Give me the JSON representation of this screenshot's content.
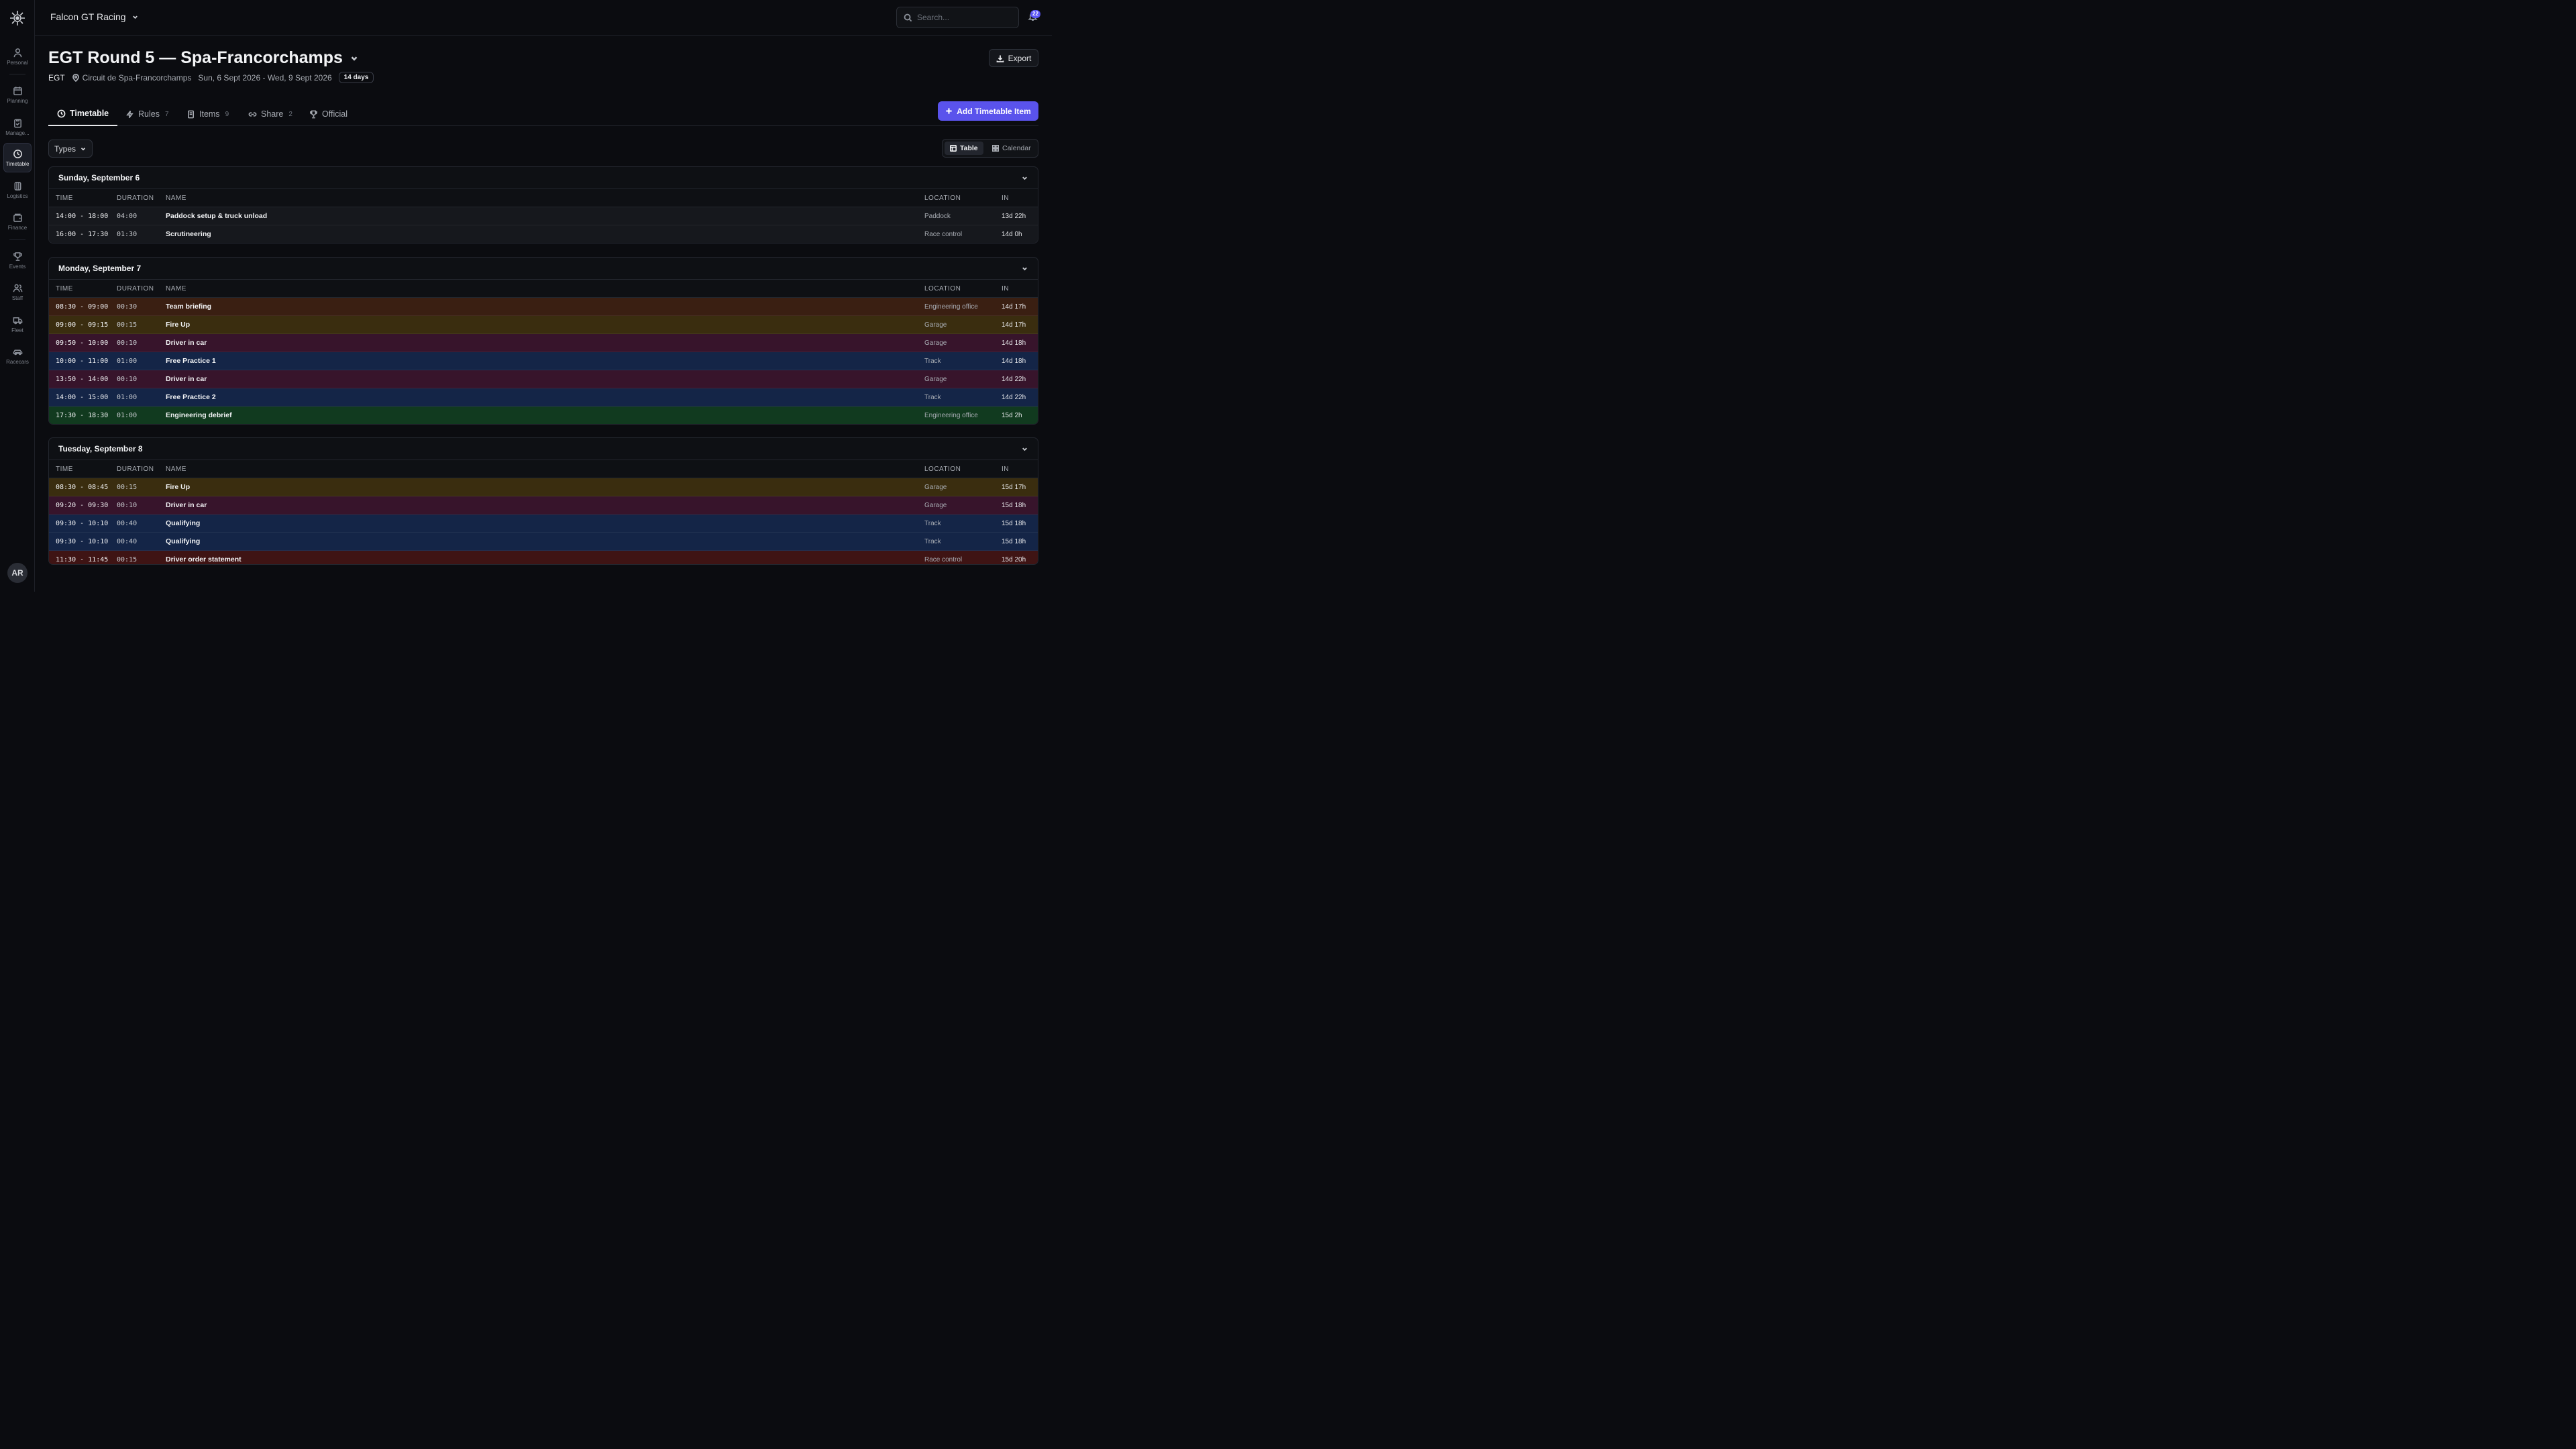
{
  "sidebar": {
    "items": [
      {
        "label": "Personal",
        "icon": "user-icon"
      },
      {
        "label": "Planning",
        "icon": "calendar-icon"
      },
      {
        "label": "Manage...",
        "icon": "clipboard-icon"
      },
      {
        "label": "Timetable",
        "icon": "clock-icon"
      },
      {
        "label": "Logistics",
        "icon": "box-icon"
      },
      {
        "label": "Finance",
        "icon": "wallet-icon"
      },
      {
        "label": "Events",
        "icon": "trophy-icon"
      },
      {
        "label": "Staff",
        "icon": "users-icon"
      },
      {
        "label": "Fleet",
        "icon": "truck-icon"
      },
      {
        "label": "Racecars",
        "icon": "car-icon"
      }
    ],
    "avatar": "AR"
  },
  "topbar": {
    "team": "Falcon GT Racing",
    "search_placeholder": "Search...",
    "notification_count": "22"
  },
  "header": {
    "title": "EGT Round 5 — Spa-Francorchamps",
    "series": "EGT",
    "circuit": "Circuit de Spa-Francorchamps",
    "dates": "Sun, 6 Sept 2026 - Wed, 9 Sept 2026",
    "duration_badge": "14 days",
    "export_label": "Export"
  },
  "tabs": [
    {
      "label": "Timetable",
      "count": ""
    },
    {
      "label": "Rules",
      "count": "7"
    },
    {
      "label": "Items",
      "count": "9"
    },
    {
      "label": "Share",
      "count": "2"
    },
    {
      "label": "Official",
      "count": ""
    }
  ],
  "add_button": "Add Timetable Item",
  "filters": {
    "types_label": "Types"
  },
  "views": {
    "table": "Table",
    "calendar": "Calendar"
  },
  "columns": {
    "time": "TIME",
    "duration": "DURATION",
    "name": "NAME",
    "location": "LOCATION",
    "in": "IN"
  },
  "colors": {
    "accent": "#5a53ec",
    "briefing": "#3a1f12",
    "fireup": "#3a2d0f",
    "driver": "#37142b",
    "session": "#142547",
    "debrief": "#113a1f",
    "statement": "#3f1414",
    "neutral": "#16181d"
  },
  "days": [
    {
      "title": "Sunday, September 6",
      "rows": [
        {
          "time": "14:00 - 18:00",
          "duration": "04:00",
          "name": "Paddock setup & truck unload",
          "location": "Paddock",
          "in": "13d 22h",
          "kind": "neutral"
        },
        {
          "time": "16:00 - 17:30",
          "duration": "01:30",
          "name": "Scrutineering",
          "location": "Race control",
          "in": "14d 0h",
          "kind": "neutral"
        }
      ]
    },
    {
      "title": "Monday, September 7",
      "rows": [
        {
          "time": "08:30 - 09:00",
          "duration": "00:30",
          "name": "Team briefing",
          "location": "Engineering office",
          "in": "14d 17h",
          "kind": "briefing"
        },
        {
          "time": "09:00 - 09:15",
          "duration": "00:15",
          "name": "Fire Up",
          "location": "Garage",
          "in": "14d 17h",
          "kind": "fireup"
        },
        {
          "time": "09:50 - 10:00",
          "duration": "00:10",
          "name": "Driver in car",
          "location": "Garage",
          "in": "14d 18h",
          "kind": "driver"
        },
        {
          "time": "10:00 - 11:00",
          "duration": "01:00",
          "name": "Free Practice 1",
          "location": "Track",
          "in": "14d 18h",
          "kind": "session"
        },
        {
          "time": "13:50 - 14:00",
          "duration": "00:10",
          "name": "Driver in car",
          "location": "Garage",
          "in": "14d 22h",
          "kind": "driver"
        },
        {
          "time": "14:00 - 15:00",
          "duration": "01:00",
          "name": "Free Practice 2",
          "location": "Track",
          "in": "14d 22h",
          "kind": "session"
        },
        {
          "time": "17:30 - 18:30",
          "duration": "01:00",
          "name": "Engineering debrief",
          "location": "Engineering office",
          "in": "15d 2h",
          "kind": "debrief"
        }
      ]
    },
    {
      "title": "Tuesday, September 8",
      "rows": [
        {
          "time": "08:30 - 08:45",
          "duration": "00:15",
          "name": "Fire Up",
          "location": "Garage",
          "in": "15d 17h",
          "kind": "fireup"
        },
        {
          "time": "09:20 - 09:30",
          "duration": "00:10",
          "name": "Driver in car",
          "location": "Garage",
          "in": "15d 18h",
          "kind": "driver"
        },
        {
          "time": "09:30 - 10:10",
          "duration": "00:40",
          "name": "Qualifying",
          "location": "Track",
          "in": "15d 18h",
          "kind": "session"
        },
        {
          "time": "09:30 - 10:10",
          "duration": "00:40",
          "name": "Qualifying",
          "location": "Track",
          "in": "15d 18h",
          "kind": "session"
        },
        {
          "time": "11:30 - 11:45",
          "duration": "00:15",
          "name": "Driver order statement",
          "location": "Race control",
          "in": "15d 20h",
          "kind": "statement"
        }
      ]
    }
  ]
}
